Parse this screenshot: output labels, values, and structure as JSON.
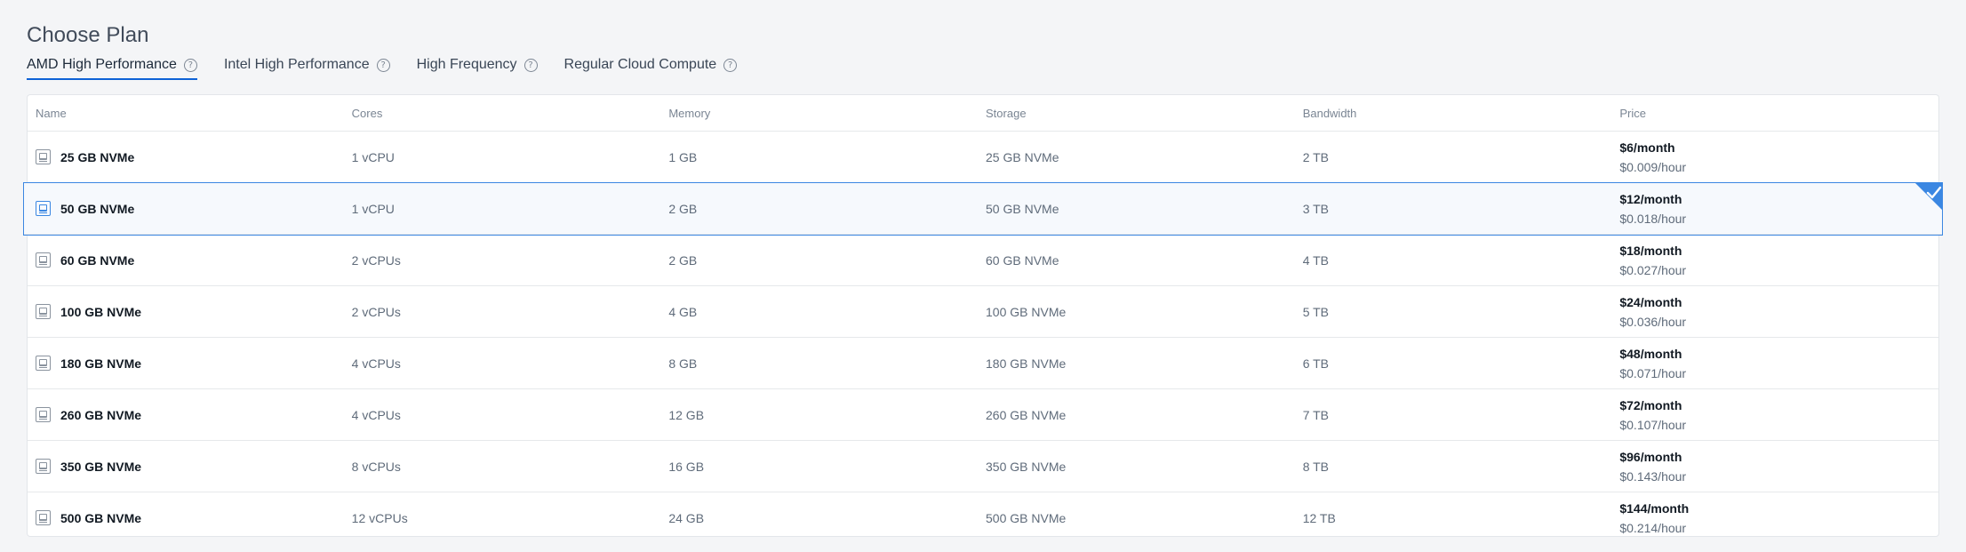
{
  "page": {
    "title": "Choose Plan"
  },
  "tabs": [
    {
      "label": "AMD High Performance",
      "active": true
    },
    {
      "label": "Intel High Performance",
      "active": false
    },
    {
      "label": "High Frequency",
      "active": false
    },
    {
      "label": "Regular Cloud Compute",
      "active": false
    }
  ],
  "help_glyph": "?",
  "table": {
    "headers": {
      "name": "Name",
      "cores": "Cores",
      "memory": "Memory",
      "storage": "Storage",
      "bandwidth": "Bandwidth",
      "price": "Price"
    },
    "rows": [
      {
        "name": "25 GB NVMe",
        "cores": "1 vCPU",
        "memory": "1 GB",
        "storage": "25 GB NVMe",
        "bandwidth": "2 TB",
        "price_month": "$6/month",
        "price_hour": "$0.009/hour"
      },
      {
        "name": "50 GB NVMe",
        "cores": "1 vCPU",
        "memory": "2 GB",
        "storage": "50 GB NVMe",
        "bandwidth": "3 TB",
        "price_month": "$12/month",
        "price_hour": "$0.018/hour",
        "selected": true
      },
      {
        "name": "60 GB NVMe",
        "cores": "2 vCPUs",
        "memory": "2 GB",
        "storage": "60 GB NVMe",
        "bandwidth": "4 TB",
        "price_month": "$18/month",
        "price_hour": "$0.027/hour"
      },
      {
        "name": "100 GB NVMe",
        "cores": "2 vCPUs",
        "memory": "4 GB",
        "storage": "100 GB NVMe",
        "bandwidth": "5 TB",
        "price_month": "$24/month",
        "price_hour": "$0.036/hour"
      },
      {
        "name": "180 GB NVMe",
        "cores": "4 vCPUs",
        "memory": "8 GB",
        "storage": "180 GB NVMe",
        "bandwidth": "6 TB",
        "price_month": "$48/month",
        "price_hour": "$0.071/hour"
      },
      {
        "name": "260 GB NVMe",
        "cores": "4 vCPUs",
        "memory": "12 GB",
        "storage": "260 GB NVMe",
        "bandwidth": "7 TB",
        "price_month": "$72/month",
        "price_hour": "$0.107/hour"
      },
      {
        "name": "350 GB NVMe",
        "cores": "8 vCPUs",
        "memory": "16 GB",
        "storage": "350 GB NVMe",
        "bandwidth": "8 TB",
        "price_month": "$96/month",
        "price_hour": "$0.143/hour"
      },
      {
        "name": "500 GB NVMe",
        "cores": "12 vCPUs",
        "memory": "24 GB",
        "storage": "500 GB NVMe",
        "bandwidth": "12 TB",
        "price_month": "$144/month",
        "price_hour": "$0.214/hour"
      }
    ]
  },
  "colors": {
    "accent": "#3b87e2",
    "tab_underline": "#0e62d6",
    "selected_row_bg": "#f6f9fd"
  },
  "icons": {
    "plan": "server-icon",
    "help": "help-circle-icon",
    "selected": "checkmark-corner-icon"
  }
}
